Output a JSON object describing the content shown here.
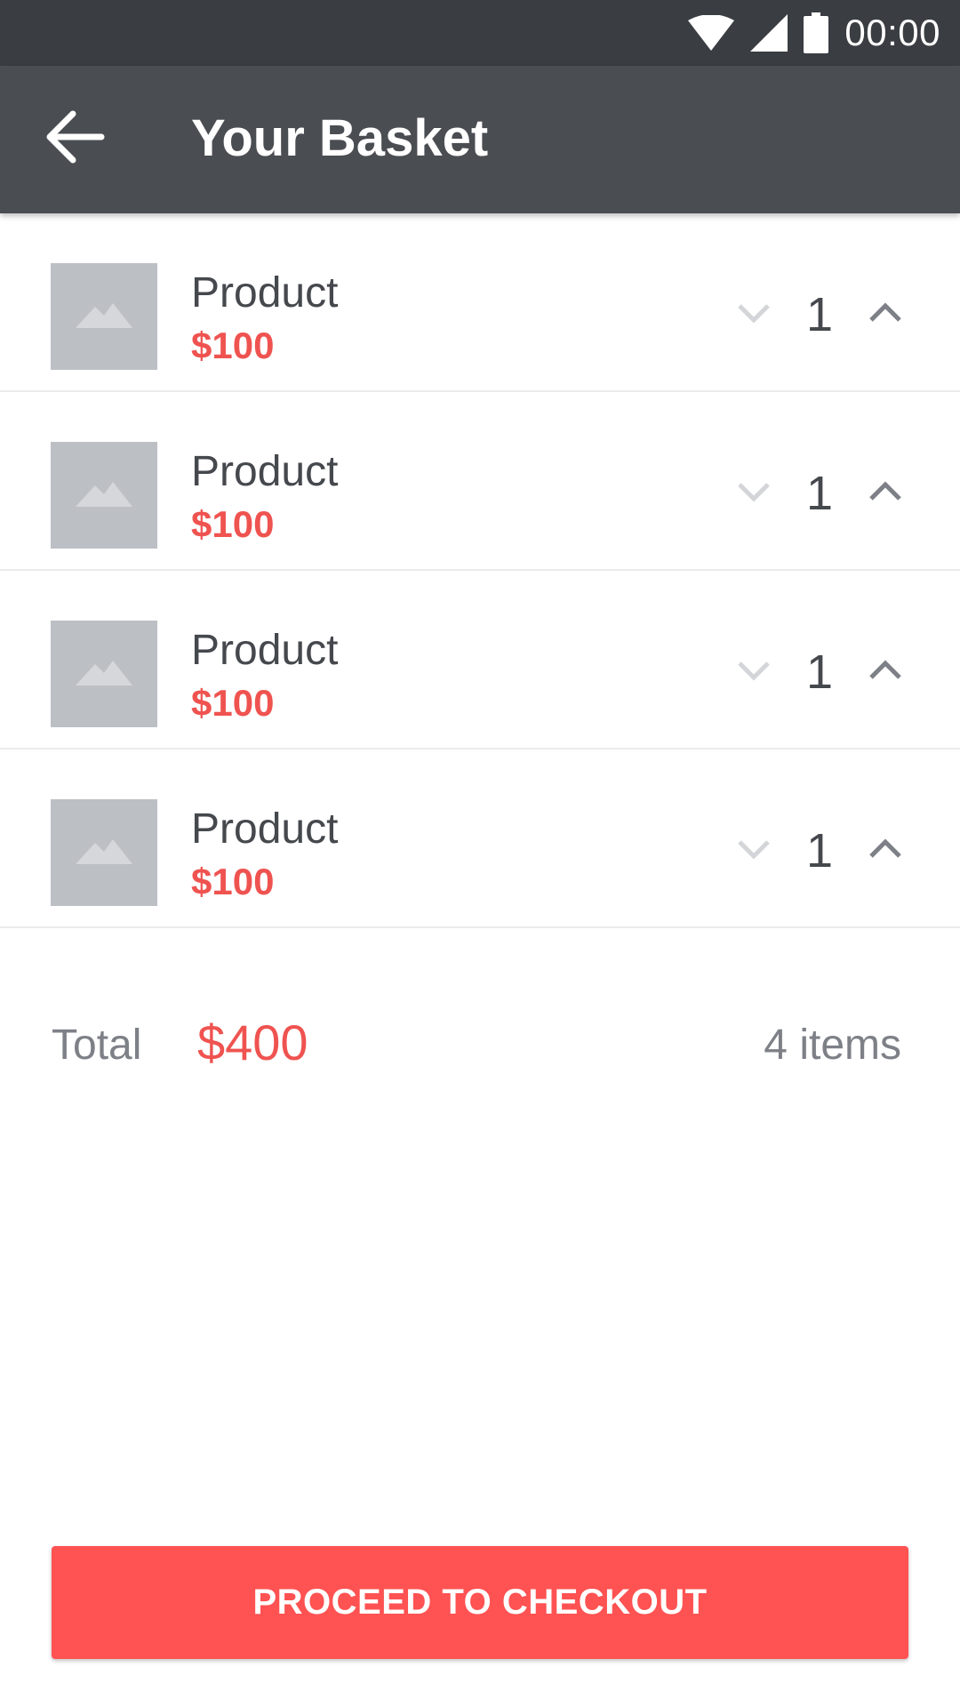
{
  "status_bar": {
    "time": "00:00",
    "icons": [
      "wifi-icon",
      "signal-icon",
      "battery-icon"
    ]
  },
  "app_bar": {
    "back_icon": "arrow-back-icon",
    "title": "Your Basket"
  },
  "items": [
    {
      "name": "Product",
      "price": "$100",
      "quantity": "1",
      "image_icon": "image-placeholder-icon"
    },
    {
      "name": "Product",
      "price": "$100",
      "quantity": "1",
      "image_icon": "image-placeholder-icon"
    },
    {
      "name": "Product",
      "price": "$100",
      "quantity": "1",
      "image_icon": "image-placeholder-icon"
    },
    {
      "name": "Product",
      "price": "$100",
      "quantity": "1",
      "image_icon": "image-placeholder-icon"
    }
  ],
  "summary": {
    "total_label": "Total",
    "total_value": "$400",
    "item_count": "4 items"
  },
  "checkout": {
    "label": "PROCEED TO CHECKOUT"
  },
  "colors": {
    "status_bar": "#3a3d42",
    "app_bar": "#4a4d52",
    "accent": "#ef5350",
    "button": "#ff5252",
    "thumb": "#bcbfc4",
    "text_primary": "#45484d",
    "text_secondary": "#7d8086"
  }
}
